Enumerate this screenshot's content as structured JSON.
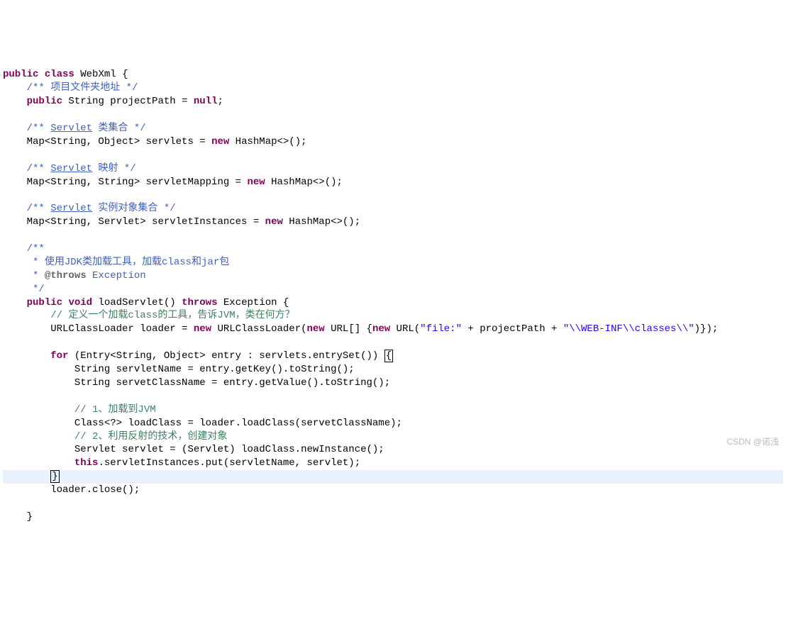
{
  "code": {
    "line1_kw1": "public",
    "line1_kw2": "class",
    "line1_class": "WebXml",
    "line1_brace": "{",
    "line2_cmt": "/** 项目文件夹地址 */",
    "line3_kw": "public",
    "line3_txt": " String projectPath = ",
    "line3_null": "null",
    "line3_semi": ";",
    "line5_cmt1": "/** ",
    "line5_link": "Servlet",
    "line5_cmt2": " 类集合 */",
    "line6_txt": "Map<String, Object> servlets = ",
    "line6_new": "new",
    "line6_txt2": " HashMap<>();",
    "line8_cmt1": "/** ",
    "line8_link": "Servlet",
    "line8_cmt2": " 映射 */",
    "line9_txt": "Map<String, String> servletMapping = ",
    "line9_new": "new",
    "line9_txt2": " HashMap<>();",
    "line11_cmt1": "/** ",
    "line11_link": "Servlet",
    "line11_cmt2": " 实例对象集合 */",
    "line12_txt": "Map<String, Servlet> servletInstances = ",
    "line12_new": "new",
    "line12_txt2": " HashMap<>();",
    "line14_cmt": "/**",
    "line15_cmt": " * 使用JDK类加载工具，加载class和jar包",
    "line16_cmt1": " * ",
    "line16_throws": "@throws",
    "line16_cmt2": " Exception",
    "line17_cmt": " */",
    "line18_kw1": "public",
    "line18_kw2": "void",
    "line18_method": " loadServlet() ",
    "line18_kw3": "throws",
    "line18_exc": " Exception {",
    "line19_cmt": "// 定义一个加载class的工具，告诉JVM，类在何方？",
    "line20_txt1": "URLClassLoader loader = ",
    "line20_new1": "new",
    "line20_txt2": " URLClassLoader(",
    "line20_new2": "new",
    "line20_txt3": " URL[] {",
    "line20_new3": "new",
    "line20_txt4": " URL(",
    "line20_str1": "\"file:\"",
    "line20_txt5": " + projectPath + ",
    "line20_str2": "\"\\\\WEB-INF\\\\classes\\\\\"",
    "line20_txt6": ")});",
    "line22_kw": "for",
    "line22_txt": " (Entry<String, Object> entry : servlets.entrySet()) ",
    "line22_brace": "{",
    "line23_txt": "String servletName = entry.getKey().toString();",
    "line24_txt": "String servetClassName = entry.getValue().toString();",
    "line26_cmt": "// 1、加载到JVM",
    "line27_txt": "Class<?> loadClass = loader.loadClass(servetClassName);",
    "line28_cmt": "// 2、利用反射的技术，创建对象",
    "line29_txt": "Servlet servlet = (Servlet) loadClass.newInstance();",
    "line30_this": "this",
    "line30_txt": ".servletInstances.put(servletName, servlet);",
    "line31_brace": "}",
    "line32_txt": "loader.close();",
    "line34_brace": "}"
  },
  "watermark": "CSDN @诺浅"
}
